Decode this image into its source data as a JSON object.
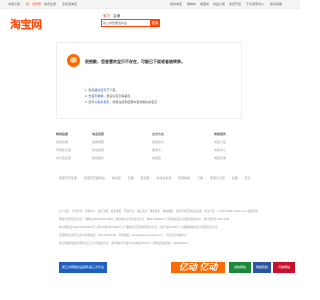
{
  "topbar": {
    "items": [
      "中国大陆",
      "亲，请登录",
      "免费注册",
      "手机逛淘宝",
      "我的淘宝",
      "购物车",
      "收藏夹",
      "商品分类",
      "免费开店",
      "千牛卖家中心",
      "联系客服"
    ]
  },
  "header": {
    "logo": "淘宝网",
    "tabs": [
      "宝贝",
      "店铺"
    ],
    "search_placeholder": "输入你想要的商品",
    "search_button": "搜索"
  },
  "notice": {
    "title": "很抱歉，您查看的宝贝不存在，可能已下架或者被转移。",
    "lines": [
      {
        "prefix": "1. 您",
        "link": "收藏的宝贝",
        "suffix": "已下架。"
      },
      {
        "prefix": "2. 去",
        "link": "首页看看",
        "suffix": "，更多好宝贝等着您"
      },
      {
        "prefix": "3. 您可以",
        "link": "联系卖家",
        "suffix": "，或者在搜索结果中查找相似的宝贝"
      }
    ]
  },
  "footer": {
    "columns": [
      {
        "heading": "购物指南",
        "items": [
          "免费注册",
          "开通支付宝",
          "支付宝充值"
        ]
      },
      {
        "heading": "淘宝保障",
        "items": [
          "发票保障",
          "售后规则",
          "缺货赔付"
        ]
      },
      {
        "heading": "支付方式",
        "items": [
          "快捷支付",
          "信用卡",
          "余额宝"
        ]
      },
      {
        "heading": "商家服务",
        "items": [
          "商家入驻",
          "商家中心",
          "淘宝智库"
        ]
      }
    ],
    "links": [
      "阿里巴巴集团",
      "阿里巴巴国际站",
      "淘宝网",
      "天猫",
      "聚划算",
      "全球速卖通",
      "阿里妈妈",
      "飞猪",
      "阿里云计算",
      "优酷",
      "钉钉"
    ],
    "legal_lines": [
      "关于淘宝　合作伙伴　营销中心　廉正举报　联系客服　开放平台　诚征英才　联系我们　网站地图　法律声明及隐私权政策　知识产权　© 2003-2023 Taobao.com 版权所有",
      "网络文化经营许可证：浙网文[2022]1034-058号 | 增值电信业务经营许可证：浙B2-20080224 | 互联网药品信息服务资格证书：(浙)-经营性-2020-0181",
      "浙公网安备 33010002000078号 | 浙ICP备09070065号 | 广播电视节目制作经营许可证：(浙)字第01088号 | 出版物网络交易平台服务许可证",
      "互联网违法和不良信息举报电话：0571-81683755　举报邮箱：jubao@service.taobao.com　不良信息举报中心",
      "医疗器械网络交易服务第三方平台备案凭证：(浙)网械平台备字[2018]第00004号 | 消费者维权热线：4008000000"
    ],
    "badges": [
      "浙江省网络食品销售第三方平台",
      "亿动 亿动",
      "诚信网站",
      "网络警察",
      "可信网站"
    ]
  }
}
